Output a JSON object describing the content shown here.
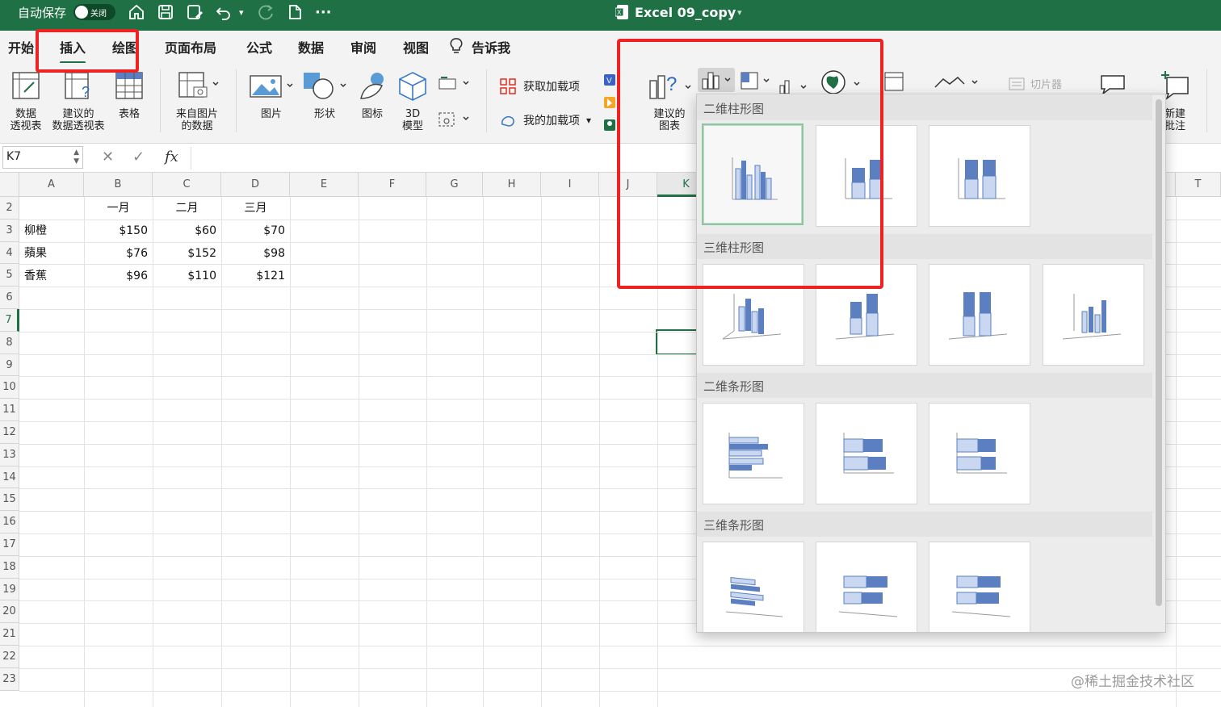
{
  "titlebar": {
    "autosave_label": "自动保存",
    "toggle_state": "关闭",
    "document_title": "Excel 09_copy",
    "more": "···",
    "bg_color": "#1f7145"
  },
  "menu": {
    "tabs": [
      "开始",
      "插入",
      "绘图",
      "页面布局",
      "公式",
      "数据",
      "审阅",
      "视图"
    ],
    "active_tab": "插入",
    "tell_me": "告诉我"
  },
  "ribbon": {
    "pivot_table": "数据\n透视表",
    "recommended_pivot": "建议的\n数据透视表",
    "table": "表格",
    "from_picture": "来自图片\n的数据",
    "pictures": "图片",
    "shapes": "形状",
    "icons": "图标",
    "model3d": "3D\n模型",
    "get_addins": "获取加载项",
    "my_addins": "我的加载项",
    "recommended_charts": "建议的\n图表",
    "slicer": "切片器",
    "new_comment": "新建\n批注"
  },
  "formula_bar": {
    "name_box": "K7",
    "cancel": "✕",
    "confirm": "✓",
    "fx": "fx",
    "value": ""
  },
  "sheet": {
    "columns": [
      "A",
      "B",
      "C",
      "D",
      "E",
      "F",
      "G",
      "H",
      "I",
      "J",
      "K",
      "T"
    ],
    "rows": [
      "2",
      "3",
      "4",
      "5",
      "6",
      "7",
      "8",
      "9",
      "10",
      "11",
      "12",
      "13",
      "14",
      "15",
      "16",
      "17",
      "18",
      "19",
      "20",
      "21",
      "22",
      "23"
    ],
    "selected_cell": "K7",
    "header_row": [
      "",
      "一月",
      "二月",
      "三月"
    ],
    "data_rows": [
      [
        "柳橙",
        "$150",
        "$60",
        "$70"
      ],
      [
        "蘋果",
        "$76",
        "$152",
        "$98"
      ],
      [
        "香蕉",
        "$96",
        "$110",
        "$121"
      ]
    ]
  },
  "chart_dropdown": {
    "sections": [
      "二维柱形图",
      "三维柱形图",
      "二维条形图",
      "三维条形图"
    ],
    "section_counts": [
      3,
      4,
      3,
      3
    ],
    "selected_index": 0
  },
  "watermark": "@稀土掘金技术社区",
  "colors": {
    "excel_green": "#1f7145",
    "highlight_red": "#ee2222",
    "chart_blue": "#5b7fc0",
    "chart_light": "#c9d8f0"
  }
}
